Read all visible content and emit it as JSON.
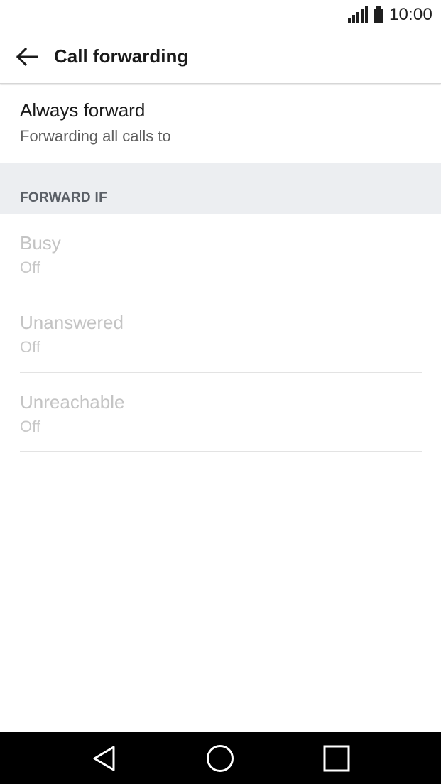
{
  "status_bar": {
    "time": "10:00",
    "signal_icon": "signal-icon",
    "battery_icon": "battery-icon"
  },
  "header": {
    "title": "Call forwarding",
    "back_icon": "arrow-left-icon"
  },
  "always_forward": {
    "title": "Always forward",
    "summary": "Forwarding all calls to"
  },
  "section": {
    "label": "FORWARD IF"
  },
  "conditions": [
    {
      "title": "Busy",
      "status": "Off"
    },
    {
      "title": "Unanswered",
      "status": "Off"
    },
    {
      "title": "Unreachable",
      "status": "Off"
    }
  ],
  "nav_bar": {
    "back": "triangle-back-icon",
    "home": "circle-home-icon",
    "recents": "square-recents-icon"
  },
  "colors": {
    "disabled_text": "#c4c4c4",
    "section_bg": "#eceef1",
    "nav_bg": "#000000"
  }
}
